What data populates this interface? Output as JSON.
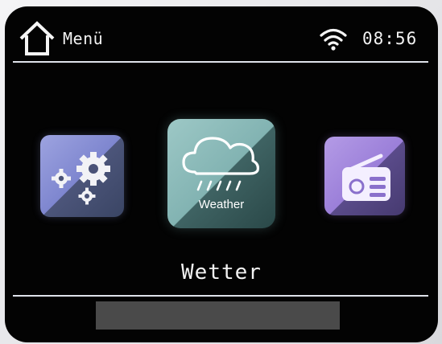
{
  "header": {
    "title": "Menü",
    "home_icon": "home-icon",
    "wifi_icon": "wifi-icon",
    "time": "08:56"
  },
  "carousel": {
    "items": [
      {
        "id": "settings",
        "icon": "settings-gears-icon",
        "label": ""
      },
      {
        "id": "weather",
        "icon": "cloud-rain-icon",
        "label": "Weather"
      },
      {
        "id": "radio",
        "icon": "radio-icon",
        "label": ""
      }
    ],
    "selected_caption": "Wetter"
  },
  "footer": {
    "hint_bar": ""
  },
  "colors": {
    "screen_bg": "#030303",
    "text": "#f2f2f2",
    "settings_tile": "#8b92d6",
    "weather_tile": "#8dbcbb",
    "radio_tile": "#a68ae0",
    "hint_bar": "#4a4a4a"
  }
}
